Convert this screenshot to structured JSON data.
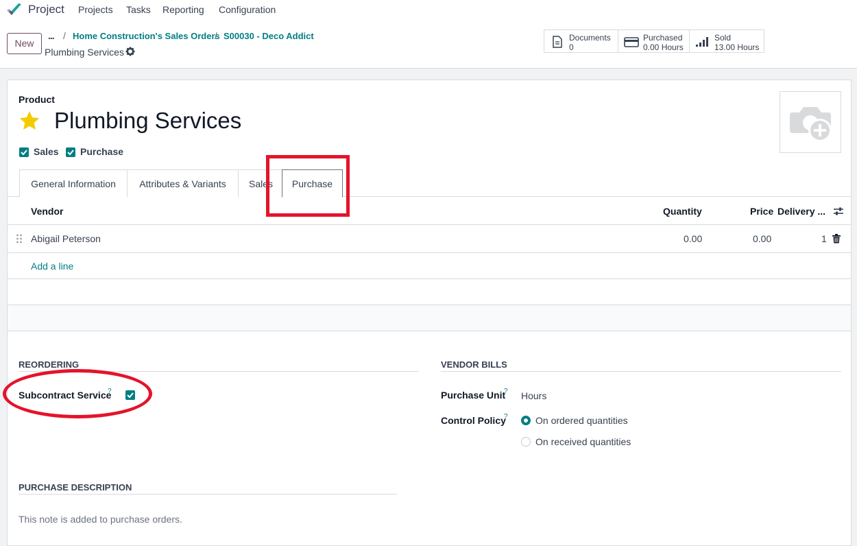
{
  "nav": {
    "app_name": "Project",
    "menu": [
      "Projects",
      "Tasks",
      "Reporting",
      "Configuration"
    ]
  },
  "control_panel": {
    "new_label": "New",
    "more_label": "...",
    "breadcrumbs": [
      "Home Construction's Sales Orders",
      "S00030 - Deco Addict"
    ],
    "current": "Plumbing Services",
    "stats": [
      {
        "label": "Documents",
        "value": "0",
        "icon": "document-icon"
      },
      {
        "label": "Purchased",
        "value": "0.00 Hours",
        "icon": "credit-card-icon"
      },
      {
        "label": "Sold",
        "value": "13.00 Hours",
        "icon": "signal-bars-icon"
      }
    ]
  },
  "product": {
    "label": "Product",
    "name": "Plumbing Services",
    "sales_label": "Sales",
    "purchase_label": "Purchase",
    "sales_checked": true,
    "purchase_checked": true
  },
  "tabs": [
    "General Information",
    "Attributes & Variants",
    "Sales",
    "Purchase"
  ],
  "active_tab": "Purchase",
  "vendor_table": {
    "columns": [
      "Vendor",
      "Quantity",
      "Price",
      "Delivery ..."
    ],
    "rows": [
      {
        "vendor": "Abigail Peterson",
        "quantity": "0.00",
        "price": "0.00",
        "delivery": "1"
      }
    ],
    "add_line": "Add a line"
  },
  "reordering": {
    "title": "REORDERING",
    "subcontract_label": "Subcontract Service",
    "subcontract_checked": true
  },
  "vendor_bills": {
    "title": "VENDOR BILLS",
    "purchase_unit_label": "Purchase Unit",
    "purchase_unit_value": "Hours",
    "control_policy_label": "Control Policy",
    "options": [
      "On ordered quantities",
      "On received quantities"
    ],
    "selected_option": "On ordered quantities"
  },
  "purchase_description": {
    "title": "PURCHASE DESCRIPTION",
    "placeholder": "This note is added to purchase orders."
  },
  "help_mark": "?",
  "colors": {
    "accent": "#017e84",
    "brand": "#714b67",
    "highlight": "#e5132b",
    "star": "#f3cc00"
  }
}
